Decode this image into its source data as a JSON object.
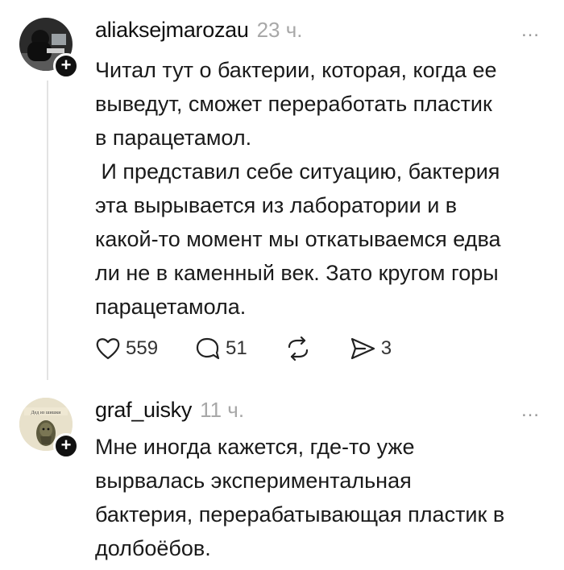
{
  "post1": {
    "username": "aliaksejmarozau",
    "time": "23 ч.",
    "more": "…",
    "text": "Читал тут о бактерии, которая, когда ее\nвыведут, сможет переработать пластик\nв парацетамол.\n И представил себе ситуацию, бактерия\nэта вырывается из лаборатории и в\nкакой-то момент мы откатываемся едва\nли не в каменный век. Зато кругом горы\nпарацетамола.",
    "likes": "559",
    "comments": "51",
    "shares": "3",
    "icons": [
      "heart-icon",
      "comment-icon",
      "repost-icon",
      "send-icon"
    ]
  },
  "post2": {
    "username": "graf_uisky",
    "time": "11 ч.",
    "more": "…",
    "avatar_caption": "Дед из шишки",
    "text": "Мне иногда кажется, где-то уже\nвырвалась экспериментальная\nбактерия, перерабатывающая пластик в\nдолбоёбов."
  },
  "colors": {
    "text": "#1a1a1a",
    "muted": "#a8a8a8",
    "line": "#e3e3e3"
  }
}
